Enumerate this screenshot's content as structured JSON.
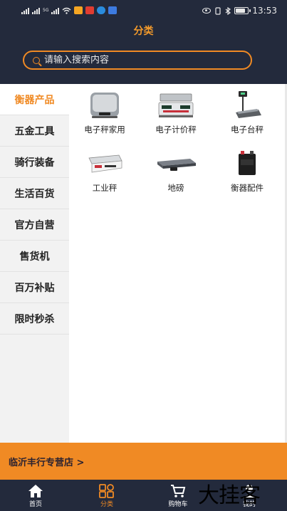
{
  "status_bar": {
    "net_label": "5G",
    "time": "13:53",
    "battery_level": 0.85
  },
  "header": {
    "title": "分类",
    "search_placeholder": "请输入搜索内容"
  },
  "sidebar": {
    "items": [
      {
        "label": "衡器产品",
        "active": true
      },
      {
        "label": "五金工具",
        "active": false
      },
      {
        "label": "骑行装备",
        "active": false
      },
      {
        "label": "生活百货",
        "active": false
      },
      {
        "label": "官方自营",
        "active": false
      },
      {
        "label": "售货机",
        "active": false
      },
      {
        "label": "百万补贴",
        "active": false
      },
      {
        "label": "限时秒杀",
        "active": false
      }
    ]
  },
  "categories": [
    {
      "label": "电子秤家用",
      "icon": "household-scale-icon"
    },
    {
      "label": "电子计价秤",
      "icon": "pricing-scale-icon"
    },
    {
      "label": "电子台秤",
      "icon": "platform-scale-icon"
    },
    {
      "label": "工业秤",
      "icon": "industrial-scale-icon"
    },
    {
      "label": "地磅",
      "icon": "floor-scale-icon"
    },
    {
      "label": "衡器配件",
      "icon": "battery-accessory-icon"
    }
  ],
  "shop": {
    "name": "临沂丰行专营店 >"
  },
  "tabbar": {
    "items": [
      {
        "label": "首页",
        "icon": "home-icon",
        "active": false
      },
      {
        "label": "分类",
        "icon": "category-icon",
        "active": true
      },
      {
        "label": "购物车",
        "icon": "cart-icon",
        "active": false
      },
      {
        "label": "我的",
        "icon": "profile-icon",
        "active": false
      }
    ]
  },
  "watermark": "大挂客",
  "colors": {
    "header_bg": "#232a3c",
    "accent": "#f08a24",
    "sidebar_bg": "#f2f2f2"
  }
}
